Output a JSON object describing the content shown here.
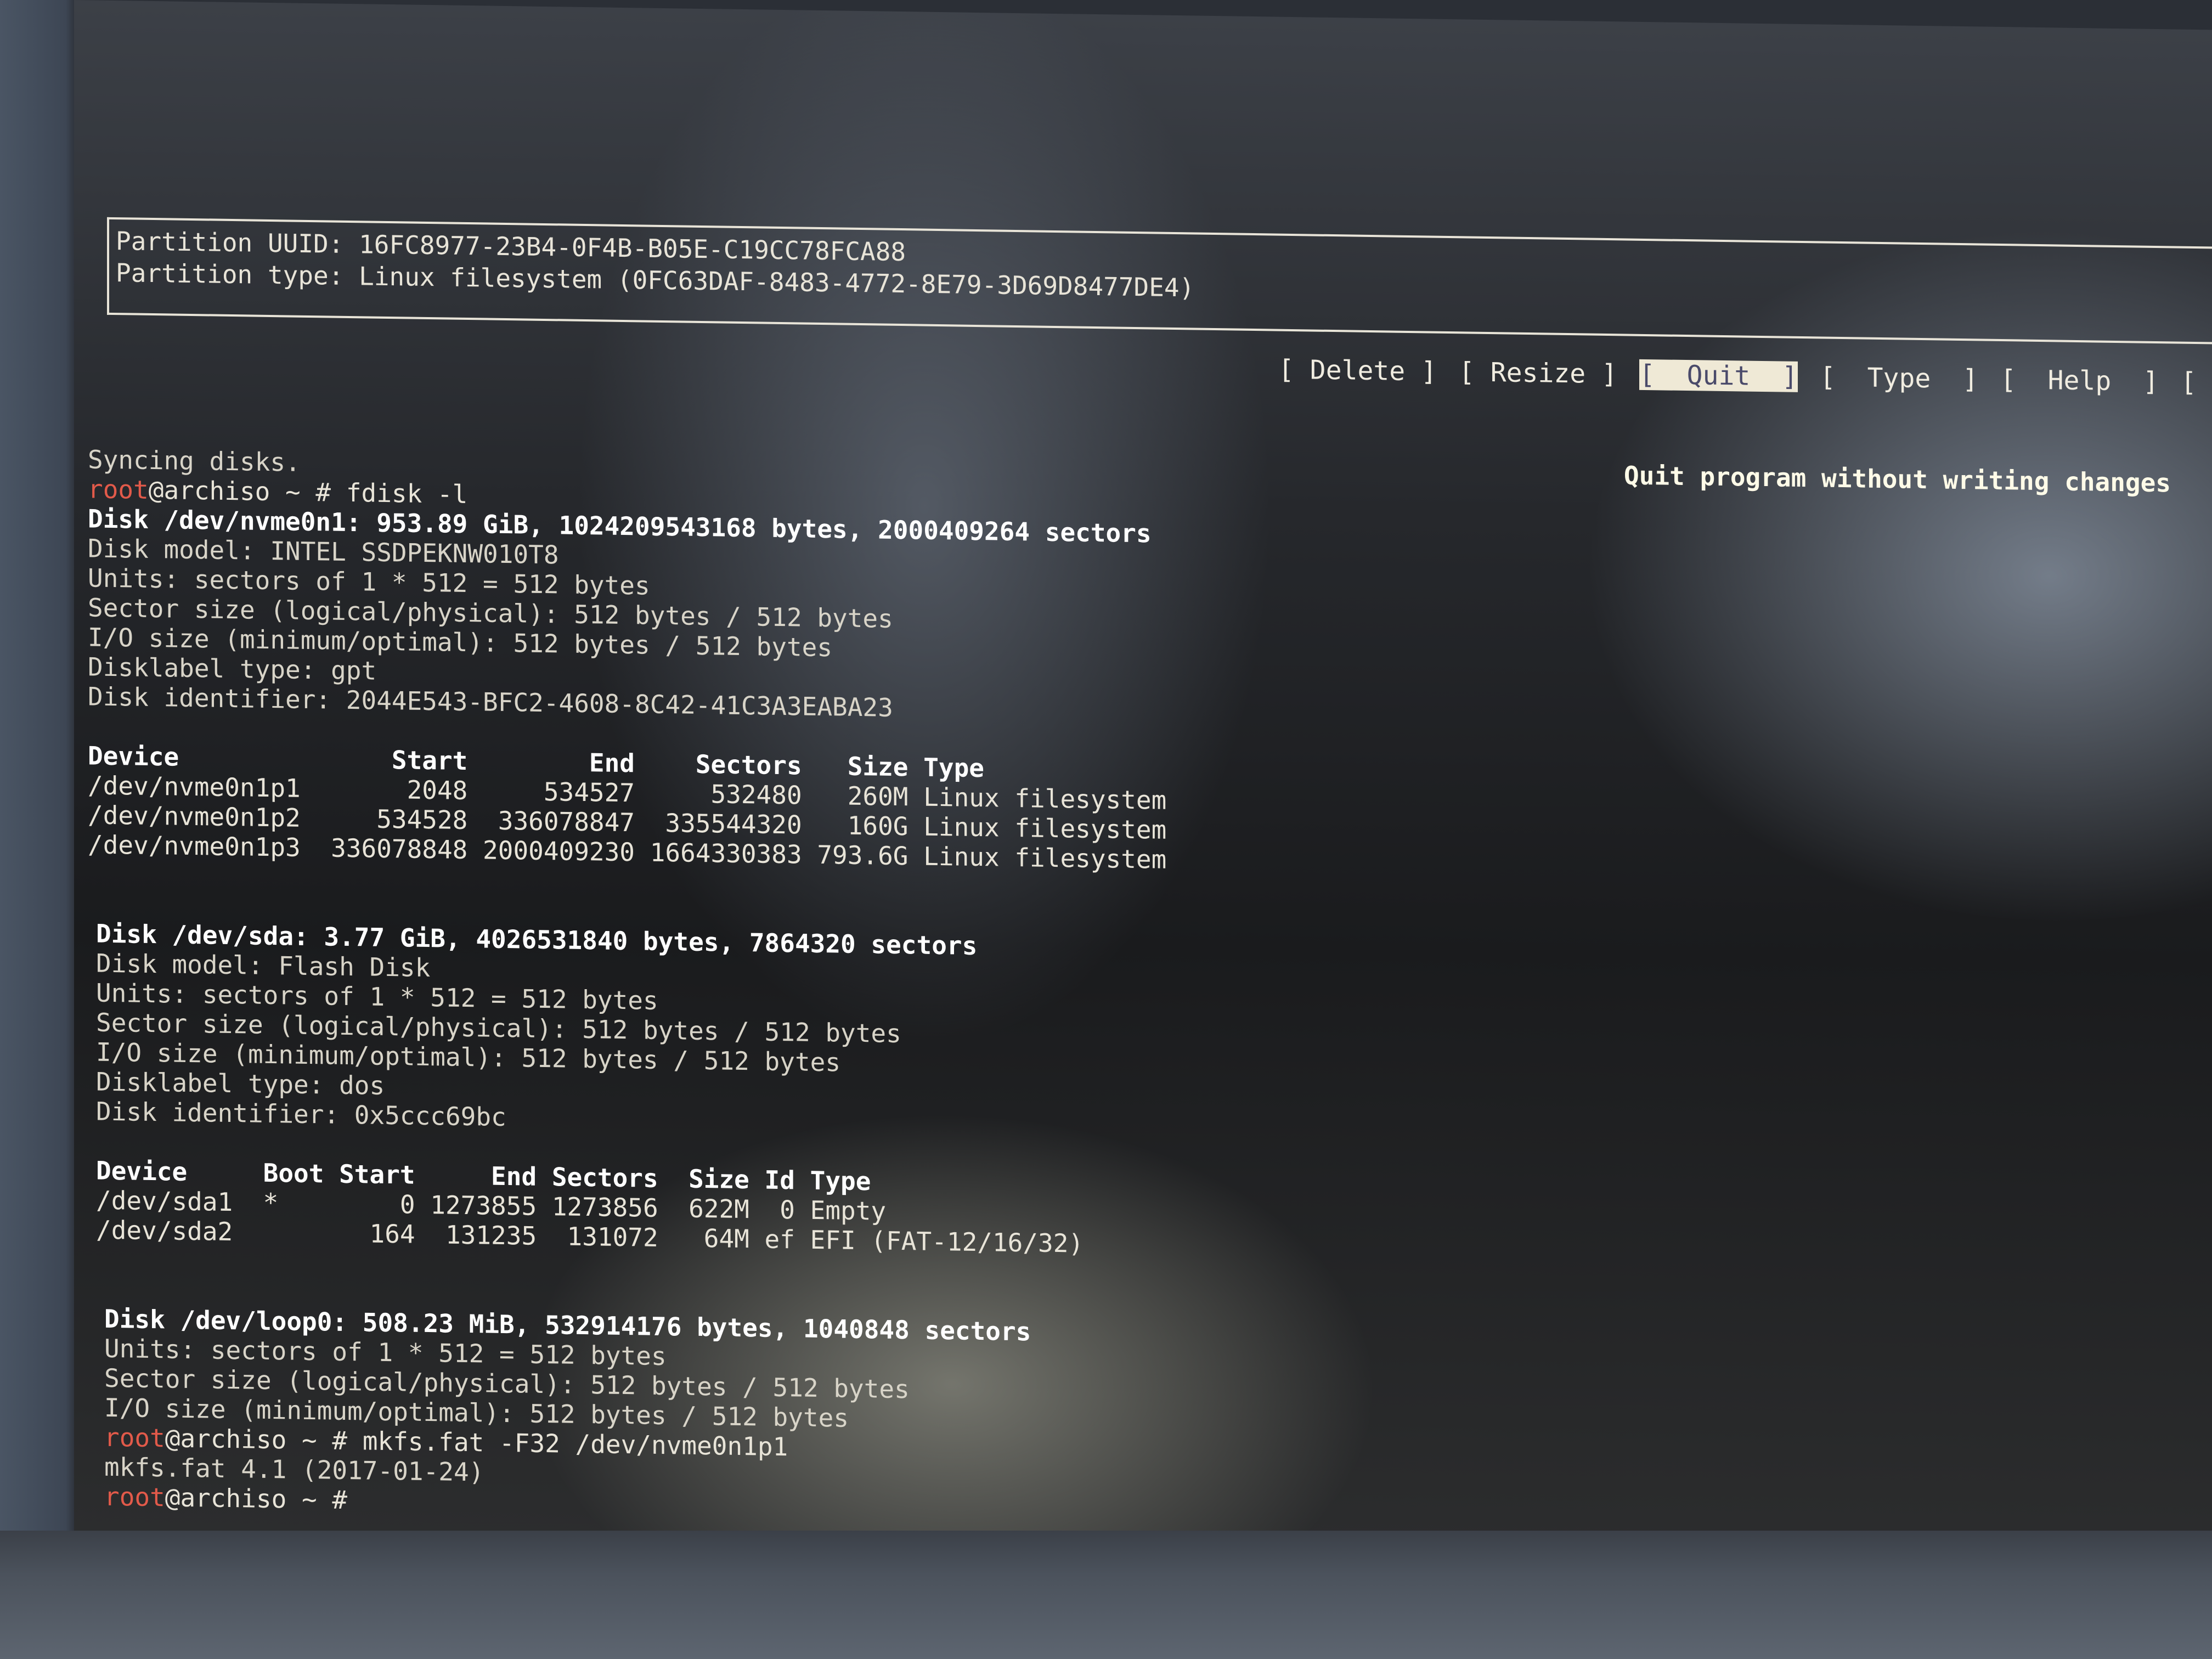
{
  "partition_info": {
    "uuid_line": "Partition UUID: 16FC8977-23B4-0F4B-B05E-C19CC78FCA88",
    "type_line": "Partition type: Linux filesystem (0FC63DAF-8483-4772-8E79-3D69D8477DE4)"
  },
  "menu": {
    "items": [
      {
        "label": "[ Delete ]"
      },
      {
        "label": "[ Resize ]"
      },
      {
        "label": "[  Quit  ]",
        "selected": true
      },
      {
        "label": "[  Type  ]"
      },
      {
        "label": "[  Help  ]"
      },
      {
        "label": "["
      }
    ],
    "hint": "Quit program without writing changes"
  },
  "terminal": {
    "syncing": "Syncing disks.",
    "prompt_user": "root",
    "prompt_rest": "@archiso ~ # ",
    "cmd1": "fdisk -l",
    "disk1": {
      "header": "Disk /dev/nvme0n1: 953.89 GiB, 1024209543168 bytes, 2000409264 sectors",
      "model": "Disk model: INTEL SSDPEKNW010T8",
      "units": "Units: sectors of 1 * 512 = 512 bytes",
      "sector_size": "Sector size (logical/physical): 512 bytes / 512 bytes",
      "io_size": "I/O size (minimum/optimal): 512 bytes / 512 bytes",
      "label_type": "Disklabel type: gpt",
      "identifier": "Disk identifier: 2044E543-BFC2-4608-8C42-41C3A3EABA23",
      "table_header": "Device              Start        End    Sectors   Size Type",
      "rows": [
        "/dev/nvme0n1p1       2048     534527     532480   260M Linux filesystem",
        "/dev/nvme0n1p2     534528  336078847  335544320   160G Linux filesystem",
        "/dev/nvme0n1p3  336078848 2000409230 1664330383 793.6G Linux filesystem"
      ]
    },
    "disk2": {
      "header": "Disk /dev/sda: 3.77 GiB, 4026531840 bytes, 7864320 sectors",
      "model": "Disk model: Flash Disk",
      "units": "Units: sectors of 1 * 512 = 512 bytes",
      "sector_size": "Sector size (logical/physical): 512 bytes / 512 bytes",
      "io_size": "I/O size (minimum/optimal): 512 bytes / 512 bytes",
      "label_type": "Disklabel type: dos",
      "identifier": "Disk identifier: 0x5ccc69bc",
      "table_header": "Device     Boot Start     End Sectors  Size Id Type",
      "rows": [
        "/dev/sda1  *        0 1273855 1273856  622M  0 Empty",
        "/dev/sda2         164  131235  131072   64M ef EFI (FAT-12/16/32)"
      ]
    },
    "disk3": {
      "header": "Disk /dev/loop0: 508.23 MiB, 532914176 bytes, 1040848 sectors",
      "units": "Units: sectors of 1 * 512 = 512 bytes",
      "sector_size": "Sector size (logical/physical): 512 bytes / 512 bytes",
      "io_size": "I/O size (minimum/optimal): 512 bytes / 512 bytes"
    },
    "cmd2": "mkfs.fat -F32 /dev/nvme0n1p1",
    "mkfs_output": "mkfs.fat 4.1 (2017-01-24)"
  }
}
